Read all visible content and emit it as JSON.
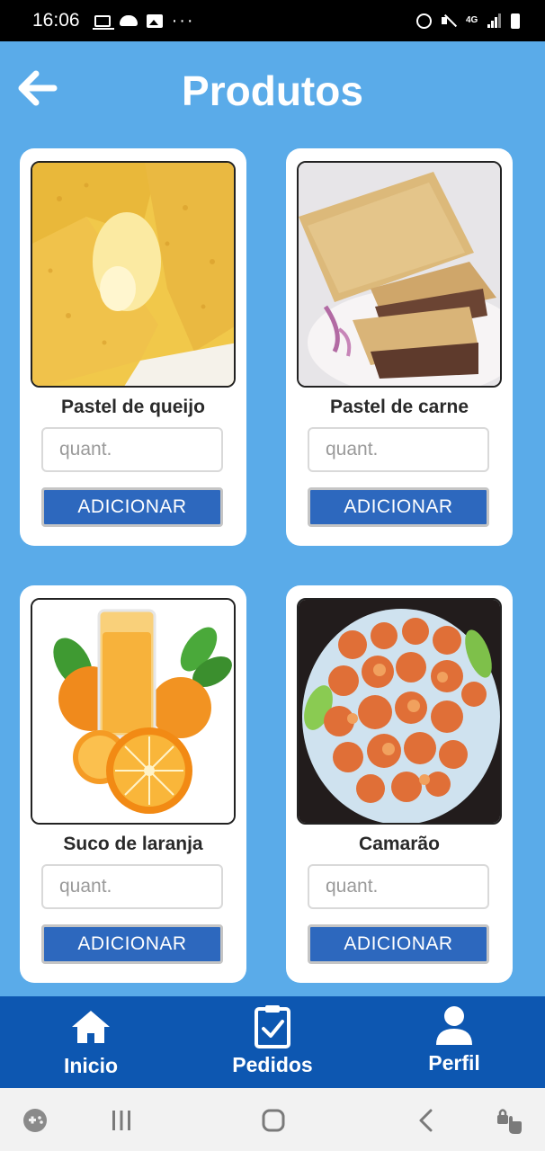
{
  "status_bar": {
    "time": "16:06",
    "left_icons": [
      "laptop-icon",
      "cloud-icon",
      "image-icon",
      "more-dots-icon"
    ],
    "right_icons": [
      "alarm-icon",
      "mute-icon",
      "network-4g-icon",
      "signal-icon",
      "battery-icon"
    ],
    "network_label": "4G"
  },
  "header": {
    "title": "Produtos",
    "back_icon": "arrow-left-icon"
  },
  "products": [
    {
      "name": "Pastel de queijo",
      "image": "pastel-queijo-image",
      "quantity_placeholder": "quant.",
      "button_label": "ADICIONAR"
    },
    {
      "name": "Pastel de carne",
      "image": "pastel-carne-image",
      "quantity_placeholder": "quant.",
      "button_label": "ADICIONAR"
    },
    {
      "name": "Suco de laranja",
      "image": "suco-laranja-image",
      "quantity_placeholder": "quant.",
      "button_label": "ADICIONAR"
    },
    {
      "name": "Camarão",
      "image": "camarao-image",
      "quantity_placeholder": "quant.",
      "button_label": "ADICIONAR"
    }
  ],
  "bottom_nav": [
    {
      "label": "Inicio",
      "icon": "home-icon"
    },
    {
      "label": "Pedidos",
      "icon": "clipboard-check-icon"
    },
    {
      "label": "Perfil",
      "icon": "user-icon"
    }
  ],
  "system_nav": [
    "game-launcher-icon",
    "recent-apps-icon",
    "home-circle-icon",
    "back-chevron-icon",
    "touch-lock-icon"
  ],
  "colors": {
    "background": "#5aabe9",
    "bottom_nav": "#0d57b1",
    "button": "#2d68be",
    "card": "#ffffff"
  }
}
